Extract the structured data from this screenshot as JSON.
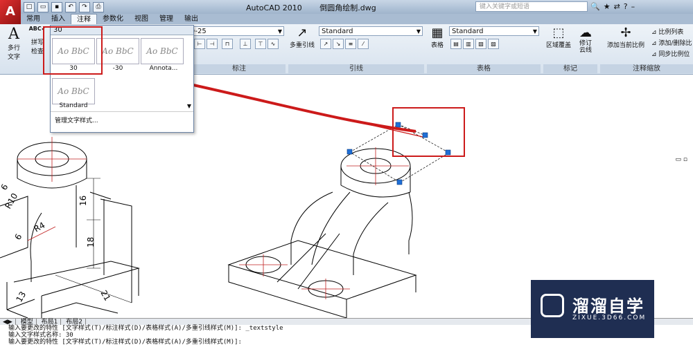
{
  "window": {
    "app": "AutoCAD 2010",
    "file": "倒圆角绘制.dwg",
    "search_placeholder": "键入关键字或短语"
  },
  "tabs": [
    "常用",
    "插入",
    "注释",
    "参数化",
    "视图",
    "管理",
    "输出"
  ],
  "ribbon": {
    "text": {
      "multiline_label": "多行\n文字",
      "spell_label": "拼写\n检查",
      "style_value": "30"
    },
    "dim": {
      "style_value": "ISO-25",
      "panel_label": "标注"
    },
    "leader": {
      "multi_label": "多重引线",
      "style_value": "Standard",
      "panel_label": "引线"
    },
    "table": {
      "table_label": "表格",
      "style_value": "Standard",
      "panel_label": "表格"
    },
    "markup": {
      "wipeout_label": "区域覆盖",
      "revcloud_label": "修订\n云线",
      "panel_label": "标记"
    },
    "scale": {
      "add_current_label": "添加当前比例",
      "list_label": "比例列表",
      "add_delete_label": "添加/删除比",
      "sync_label": "同步比例位",
      "panel_label": "注释缩放"
    }
  },
  "dropdown": {
    "styles": [
      {
        "preview": "Ao BbC",
        "name": "30",
        "selected": true
      },
      {
        "preview": "Ao BbC",
        "name": "-30",
        "selected": false
      },
      {
        "preview": "Ao BbC",
        "name": "Annota...",
        "selected": false
      },
      {
        "preview": "Ao BbC",
        "name": "Standard",
        "selected": false
      }
    ],
    "manage_label": "管理文字样式..."
  },
  "drawing": {
    "dimensions": [
      "16",
      "18",
      "21",
      "R10",
      "R4",
      "6",
      "6",
      "13"
    ]
  },
  "layout_tabs": [
    "模型",
    "布局1",
    "布局2"
  ],
  "command_lines": [
    "输入要更改的特性 [文字样式(T)/标注样式(D)/表格样式(A)/多重引线样式(M)]: _textstyle",
    "输入文字样式名称: 30",
    "输入要更改的特性 [文字样式(T)/标注样式(D)/表格样式(A)/多重引线样式(M)]:"
  ],
  "watermark": {
    "cn": "溜溜自学",
    "en": "ZIXUE.3D66.COM"
  },
  "colors": {
    "highlight_red": "#cc1a1a",
    "grip_blue": "#1f6fd6",
    "ribbon_bg": "#dfe8f2"
  }
}
